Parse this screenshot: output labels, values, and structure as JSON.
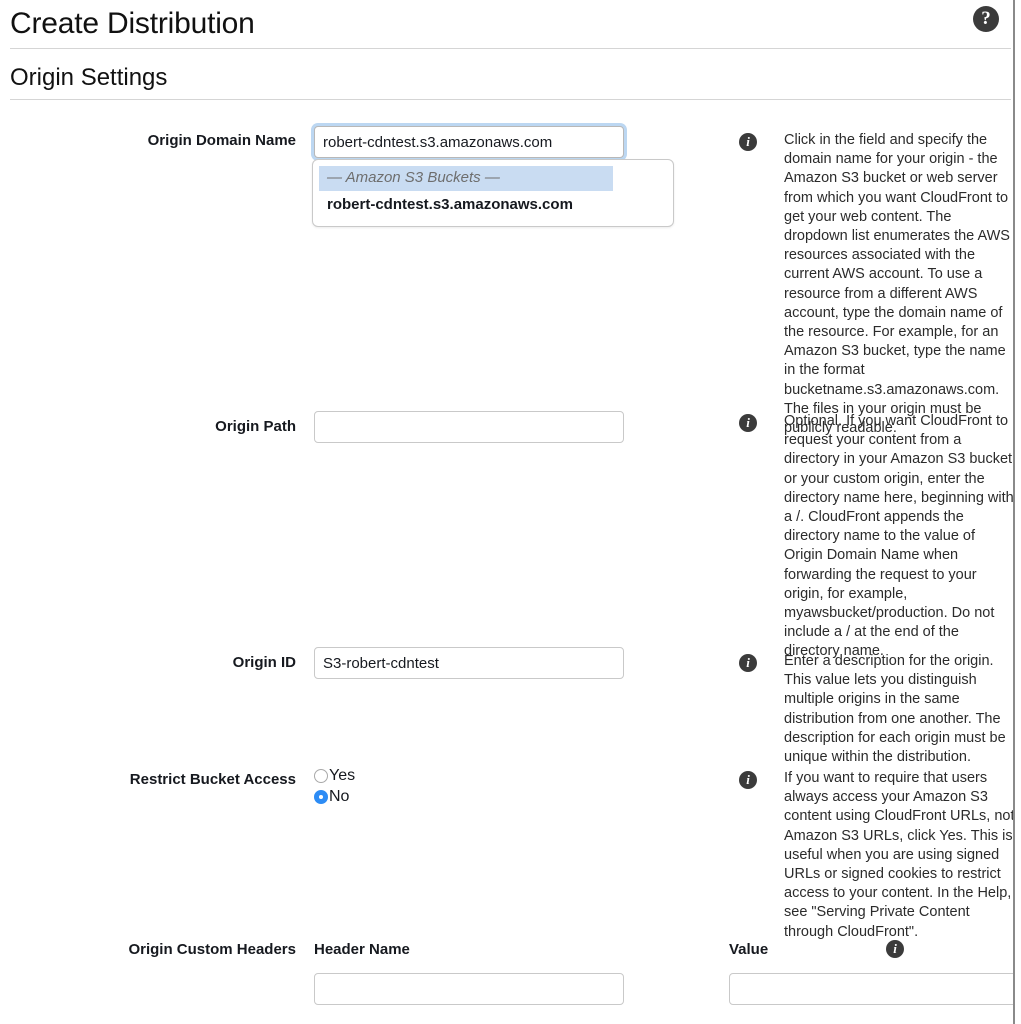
{
  "page": {
    "title": "Create Distribution",
    "section_title": "Origin Settings",
    "help_badge_icon": "question-mark-circle-icon"
  },
  "fields": {
    "origin_domain_name": {
      "label": "Origin Domain Name",
      "value": "robert-cdntest.s3.amazonaws.com",
      "placeholder": "",
      "focused": true,
      "dropdown": {
        "group_label": "— Amazon S3 Buckets —",
        "options": [
          "robert-cdntest.s3.amazonaws.com"
        ]
      },
      "help": "Click in the field and specify the domain name for your origin - the Amazon S3 bucket or web server from which you want CloudFront to get your web content. The dropdown list enumerates the AWS resources associated with the current AWS account. To use a resource from a different AWS account, type the domain name of the resource. For example, for an Amazon S3 bucket, type the name in the format bucketname.s3.amazonaws.com. The files in your origin must be publicly readable."
    },
    "origin_path": {
      "label": "Origin Path",
      "value": "",
      "placeholder": "",
      "help": "Optional. If you want CloudFront to request your content from a directory in your Amazon S3 bucket or your custom origin, enter the directory name here, beginning with a /. CloudFront appends the directory name to the value of Origin Domain Name when forwarding the request to your origin, for example, myawsbucket/production. Do not include a / at the end of the directory name."
    },
    "origin_id": {
      "label": "Origin ID",
      "value": "S3-robert-cdntest",
      "placeholder": "",
      "help": "Enter a description for the origin. This value lets you distinguish multiple origins in the same distribution from one another. The description for each origin must be unique within the distribution."
    },
    "restrict_bucket_access": {
      "label": "Restrict Bucket Access",
      "options": [
        {
          "label": "Yes",
          "selected": false
        },
        {
          "label": "No",
          "selected": true
        }
      ],
      "help": "If you want to require that users always access your Amazon S3 content using CloudFront URLs, not Amazon S3 URLs, click Yes. This is useful when you are using signed URLs or signed cookies to restrict access to your content. In the Help, see \"Serving Private Content through CloudFront\"."
    },
    "origin_custom_headers": {
      "label": "Origin Custom Headers",
      "header_name_label": "Header Name",
      "header_name_value": "",
      "value_label": "Value",
      "value_value": "",
      "help": ""
    }
  },
  "icons": {
    "info": "info-circle-icon",
    "help": "question-mark-circle-icon"
  },
  "colors": {
    "accent_radio": "#2d8cf5",
    "dropdown_highlight": "#c9dcf2",
    "focus_ring": "#bcd7f2",
    "rule": "#d5d5d5",
    "text": "#16191f"
  }
}
